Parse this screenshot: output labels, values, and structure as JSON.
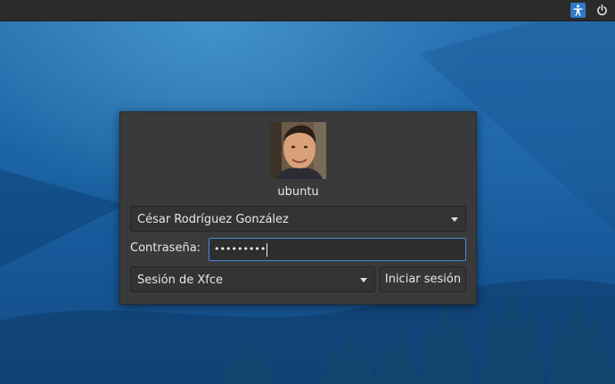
{
  "topbar": {
    "icons": [
      "accessibility-icon",
      "power-icon"
    ]
  },
  "login": {
    "avatar_icon": "user-photo",
    "username": "ubuntu",
    "selected_user": "César Rodríguez González",
    "password_label": "Contraseña:",
    "password_mask": "•••••••••",
    "selected_session": "Sesión de Xfce",
    "login_button": "Iniciar sesión"
  },
  "colors": {
    "panel_bg": "#3a3a3a",
    "focus_border": "#4a8ad8",
    "topbar_bg": "#2b2b2b",
    "accessibility_bg": "#2f79c6"
  }
}
